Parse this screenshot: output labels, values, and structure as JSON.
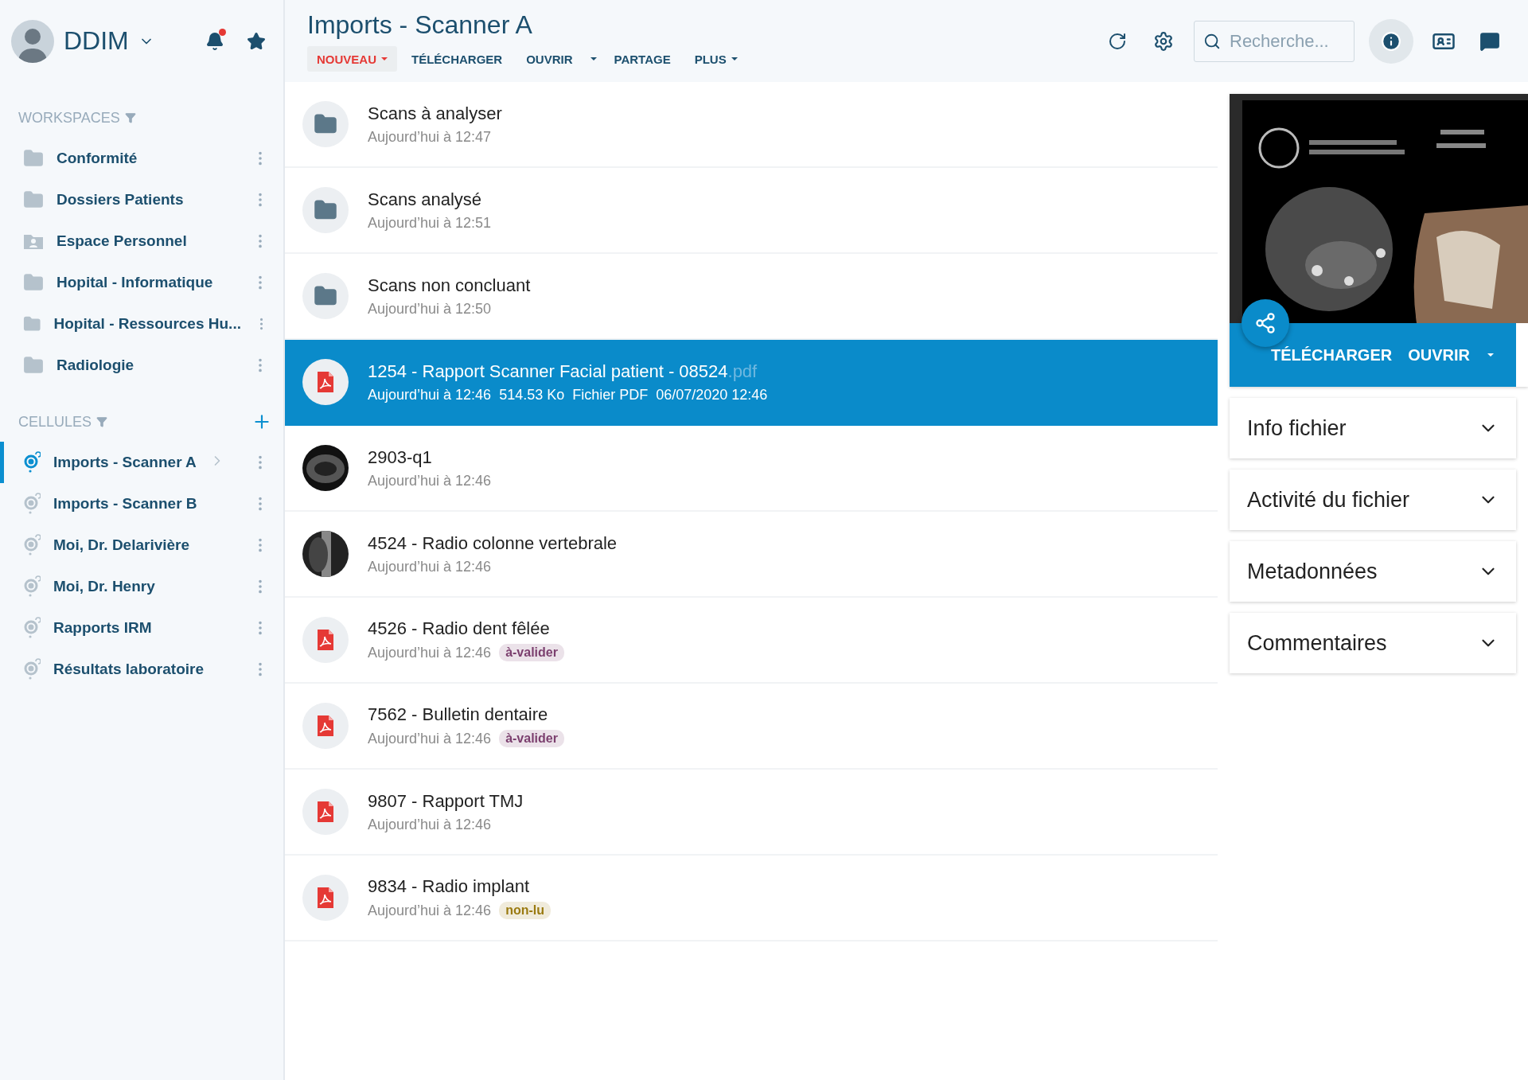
{
  "user": {
    "name": "DDIM",
    "has_notifications": true
  },
  "workspaces": {
    "title": "WORKSPACES",
    "items": [
      {
        "label": "Conformité",
        "kind": "folder"
      },
      {
        "label": "Dossiers Patients",
        "kind": "folder"
      },
      {
        "label": "Espace Personnel",
        "kind": "personal"
      },
      {
        "label": "Hopital - Informatique",
        "kind": "folder"
      },
      {
        "label": "Hopital - Ressources Hu...",
        "kind": "folder"
      },
      {
        "label": "Radiologie",
        "kind": "folder"
      }
    ]
  },
  "cells": {
    "title": "CELLULES",
    "items": [
      {
        "label": "Imports - Scanner A",
        "selected": true
      },
      {
        "label": "Imports - Scanner B",
        "selected": false
      },
      {
        "label": "Moi, Dr. Delarivière",
        "selected": false
      },
      {
        "label": "Moi, Dr. Henry",
        "selected": false
      },
      {
        "label": "Rapports IRM",
        "selected": false
      },
      {
        "label": "Résultats laboratoire",
        "selected": false
      }
    ]
  },
  "title": "Imports - Scanner A",
  "actions": [
    {
      "label": "NOUVEAU",
      "kind": "primary",
      "dropdown": true
    },
    {
      "label": "TÉLÉCHARGER",
      "kind": "plain",
      "dropdown": false
    },
    {
      "label": "OUVRIR",
      "kind": "split",
      "dropdown": true
    },
    {
      "label": "PARTAGE",
      "kind": "plain",
      "dropdown": false
    },
    {
      "label": "PLUS",
      "kind": "plain",
      "dropdown": true
    }
  ],
  "search": {
    "placeholder": "Recherche..."
  },
  "info_selected": true,
  "files": [
    {
      "kind": "folder",
      "name": "Scans à analyser",
      "meta": [
        "Aujourd’hui à 12:47"
      ],
      "selected": false
    },
    {
      "kind": "folder",
      "name": "Scans analysé",
      "meta": [
        "Aujourd’hui à 12:51"
      ],
      "selected": false
    },
    {
      "kind": "folder",
      "name": "Scans non concluant",
      "meta": [
        "Aujourd’hui à 12:50"
      ],
      "selected": false
    },
    {
      "kind": "pdf",
      "name": "1254 - Rapport Scanner Facial patient - 08524",
      "extension": ".pdf",
      "meta": [
        "Aujourd’hui à 12:46",
        "514.53 Ko",
        "Fichier PDF",
        "06/07/2020 12:46"
      ],
      "selected": true
    },
    {
      "kind": "scan",
      "name": "2903-q1",
      "meta": [
        "Aujourd’hui à 12:46"
      ],
      "selected": false
    },
    {
      "kind": "xray",
      "name": "4524 - Radio colonne vertebrale",
      "meta": [
        "Aujourd’hui à 12:46"
      ],
      "selected": false
    },
    {
      "kind": "pdf",
      "name": "4526 - Radio dent fêlée",
      "meta": [
        "Aujourd’hui à 12:46"
      ],
      "tag": {
        "label": "à-valider",
        "color": "#7b3f6e"
      },
      "selected": false
    },
    {
      "kind": "pdf",
      "name": "7562 - Bulletin dentaire",
      "meta": [
        "Aujourd’hui à 12:46"
      ],
      "tag": {
        "label": "à-valider",
        "color": "#7b3f6e"
      },
      "selected": false
    },
    {
      "kind": "pdf",
      "name": "9807 - Rapport TMJ",
      "meta": [
        "Aujourd’hui à 12:46"
      ],
      "selected": false
    },
    {
      "kind": "pdf",
      "name": "9834 - Radio implant",
      "meta": [
        "Aujourd’hui à 12:46"
      ],
      "tag": {
        "label": "non-lu",
        "color": "#9a7a10"
      },
      "selected": false
    }
  ],
  "preview": {
    "kind": "picture",
    "buttons": [
      {
        "label": "TÉLÉCHARGER",
        "dropdown": false
      },
      {
        "label": "OUVRIR",
        "dropdown": true
      }
    ]
  },
  "sections": [
    {
      "label": "Info fichier",
      "expanded": false
    },
    {
      "label": "Activité du fichier",
      "expanded": false
    },
    {
      "label": "Metadonnées",
      "expanded": false
    },
    {
      "label": "Commentaires",
      "expanded": false
    }
  ]
}
